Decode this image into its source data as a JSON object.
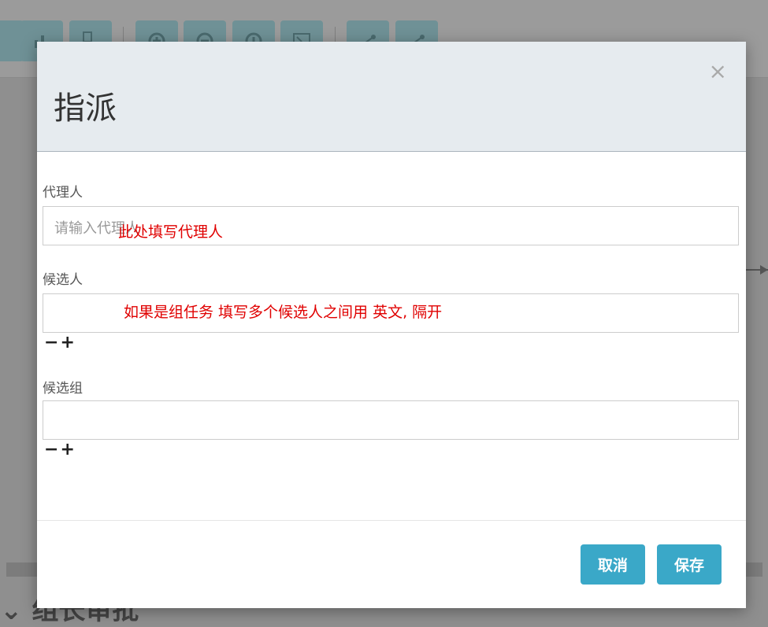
{
  "dialog": {
    "title": "指派",
    "close_label": "×",
    "assignee": {
      "label": "代理人",
      "placeholder": "请输入代理人",
      "annotation": "此处填写代理人"
    },
    "candidate_users": {
      "label": "候选人",
      "annotation": "如果是组任务 填写多个候选人之间用 英文, 隔开",
      "minus": "−",
      "plus": "+"
    },
    "candidate_groups": {
      "label": "候选组",
      "minus": "−",
      "plus": "+"
    },
    "buttons": {
      "cancel": "取消",
      "save": "保存"
    }
  },
  "background": {
    "bottom_title": "⌄ 组长审批"
  },
  "colors": {
    "primary_button": "#3aa8c8",
    "annotation_red": "#e00000",
    "header_bg": "#e6ebef"
  }
}
